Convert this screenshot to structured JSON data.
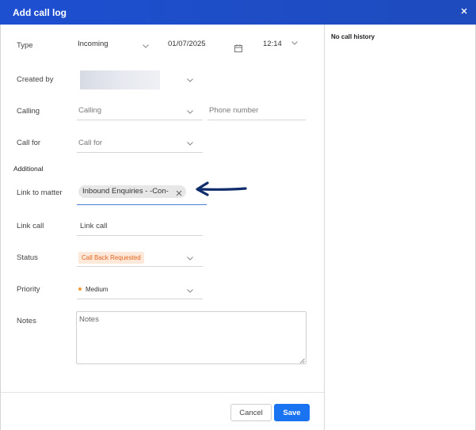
{
  "dialog": {
    "title": "Add call log"
  },
  "labels": {
    "type": "Type",
    "created_by": "Created by",
    "calling": "Calling",
    "call_for": "Call for",
    "additional": "Additional",
    "link_to_matter": "Link to matter",
    "link_call": "Link call",
    "status": "Status",
    "priority": "Priority",
    "notes": "Notes"
  },
  "fields": {
    "type_value": "Incoming",
    "date_value": "01/07/2025",
    "time_value": "12:14",
    "calling_placeholder": "Calling",
    "phone_placeholder": "Phone number",
    "call_for_placeholder": "Call for",
    "matter_chip": "Inbound Enquiries - -Con-",
    "link_call_placeholder": "Link call",
    "status_value": "Call Back Requested",
    "priority_value": "Medium",
    "notes_placeholder": "Notes"
  },
  "status_colors": {
    "status_bg": "#fde8da",
    "status_text": "#e0651d",
    "priority_dot": "#f19b3c"
  },
  "sidebar": {
    "history_text": "No call history"
  },
  "footer": {
    "cancel_label": "Cancel",
    "save_label": "Save"
  },
  "colors": {
    "header": "#1d4fd1",
    "primary_button": "#1a73f0",
    "annotation_arrow": "#0f2c6b"
  },
  "icons": {
    "close": "close-icon",
    "calendar": "calendar-icon",
    "dropdown": "chevron-down-icon",
    "chip_remove": "remove-chip-icon",
    "annotation": "arrow-left-icon"
  }
}
